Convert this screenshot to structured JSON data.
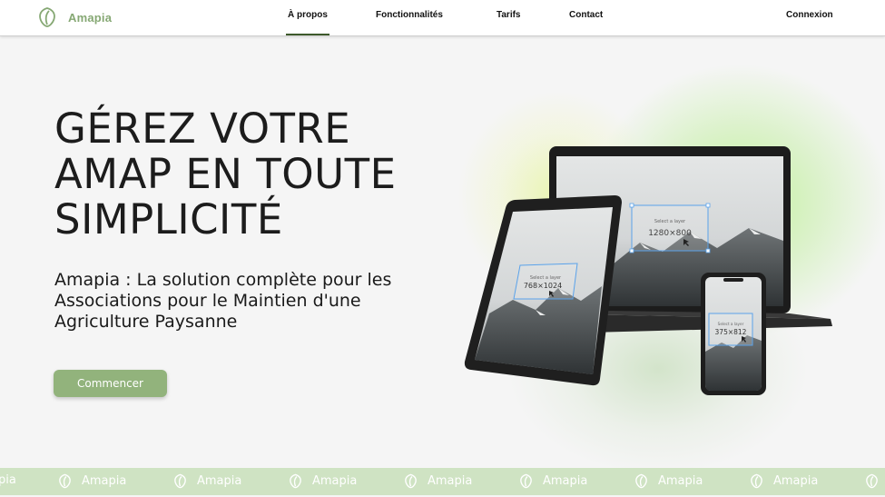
{
  "brand": {
    "name": "Amapia",
    "logo_icon": "leaf-icon",
    "color": "#86a874"
  },
  "nav": {
    "links": [
      {
        "label": "À propos",
        "active": true
      },
      {
        "label": "Fonctionnalités",
        "active": false
      },
      {
        "label": "Tarifs",
        "active": false
      },
      {
        "label": "Contact",
        "active": false
      }
    ],
    "login": "Connexion"
  },
  "hero": {
    "title_lines": [
      "GÉREZ VOTRE",
      "AMAP EN TOUTE",
      "SIMPLICITÉ"
    ],
    "subtitle_lines": [
      "Amapia : La solution complète pour les",
      "Associations pour le Maintien d'une",
      "Agriculture Paysanne"
    ],
    "cta": "Commencer",
    "cta_color": "#92b37c"
  },
  "devices": {
    "laptop": {
      "layer_label": "Select a layer",
      "size": "1280×800"
    },
    "tablet": {
      "layer_label": "Select a layer",
      "size": "768×1024"
    },
    "phone": {
      "layer_label": "Select a layer",
      "size": "375×812"
    }
  },
  "marquee": {
    "partial_label": "pia",
    "label": "Amapia",
    "icon": "leaf-icon",
    "background": "#cfe3c3"
  }
}
